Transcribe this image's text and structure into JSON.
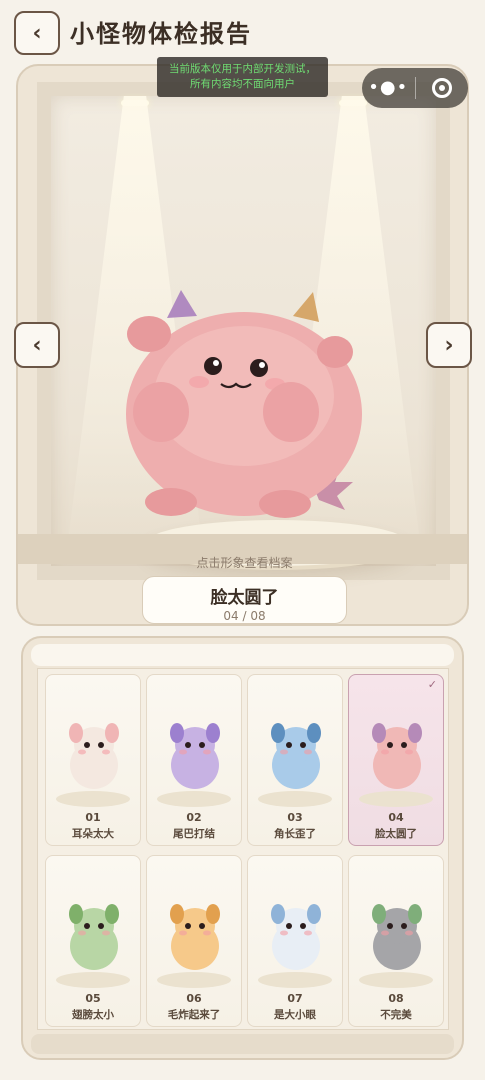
{
  "header": {
    "back_label": "‹",
    "title": "小怪物体检报告"
  },
  "dev_banner": {
    "line1": "当前版本仅用于内部开发测试，",
    "line2": "所有内容均不面向用户"
  },
  "capsule": {
    "more_label": "•●•"
  },
  "showcase": {
    "prev_label": "‹",
    "next_label": "›",
    "tap_hint": "点击形象查看档案",
    "current_name": "脸太圆了",
    "current_index": "04 / 08"
  },
  "monsters": [
    {
      "num": "01",
      "label": "耳朵太大",
      "color": "#f4e8e0",
      "accent": "#f0b5b5",
      "selected": false
    },
    {
      "num": "02",
      "label": "尾巴打结",
      "color": "#c7b2e3",
      "accent": "#9c80cf",
      "selected": false
    },
    {
      "num": "03",
      "label": "角长歪了",
      "color": "#a9cbe9",
      "accent": "#5d8fbf",
      "selected": false
    },
    {
      "num": "04",
      "label": "脸太圆了",
      "color": "#f0b8b6",
      "accent": "#b58ab8",
      "selected": true
    },
    {
      "num": "05",
      "label": "翅膀太小",
      "color": "#b8d6a5",
      "accent": "#7fb06a",
      "selected": false
    },
    {
      "num": "06",
      "label": "毛炸起来了",
      "color": "#f6c98a",
      "accent": "#e2a04e",
      "selected": false
    },
    {
      "num": "07",
      "label": "是大小眼",
      "color": "#e8eef5",
      "accent": "#8fb3d8",
      "selected": false
    },
    {
      "num": "08",
      "label": "不完美",
      "color": "#a5a5a8",
      "accent": "#7fae7a",
      "selected": false
    }
  ],
  "colors": {
    "background": "#f6f2ea",
    "border": "#6b5646",
    "selected_card": "#f0dde3",
    "dev_banner_text": "#6fdc73"
  }
}
